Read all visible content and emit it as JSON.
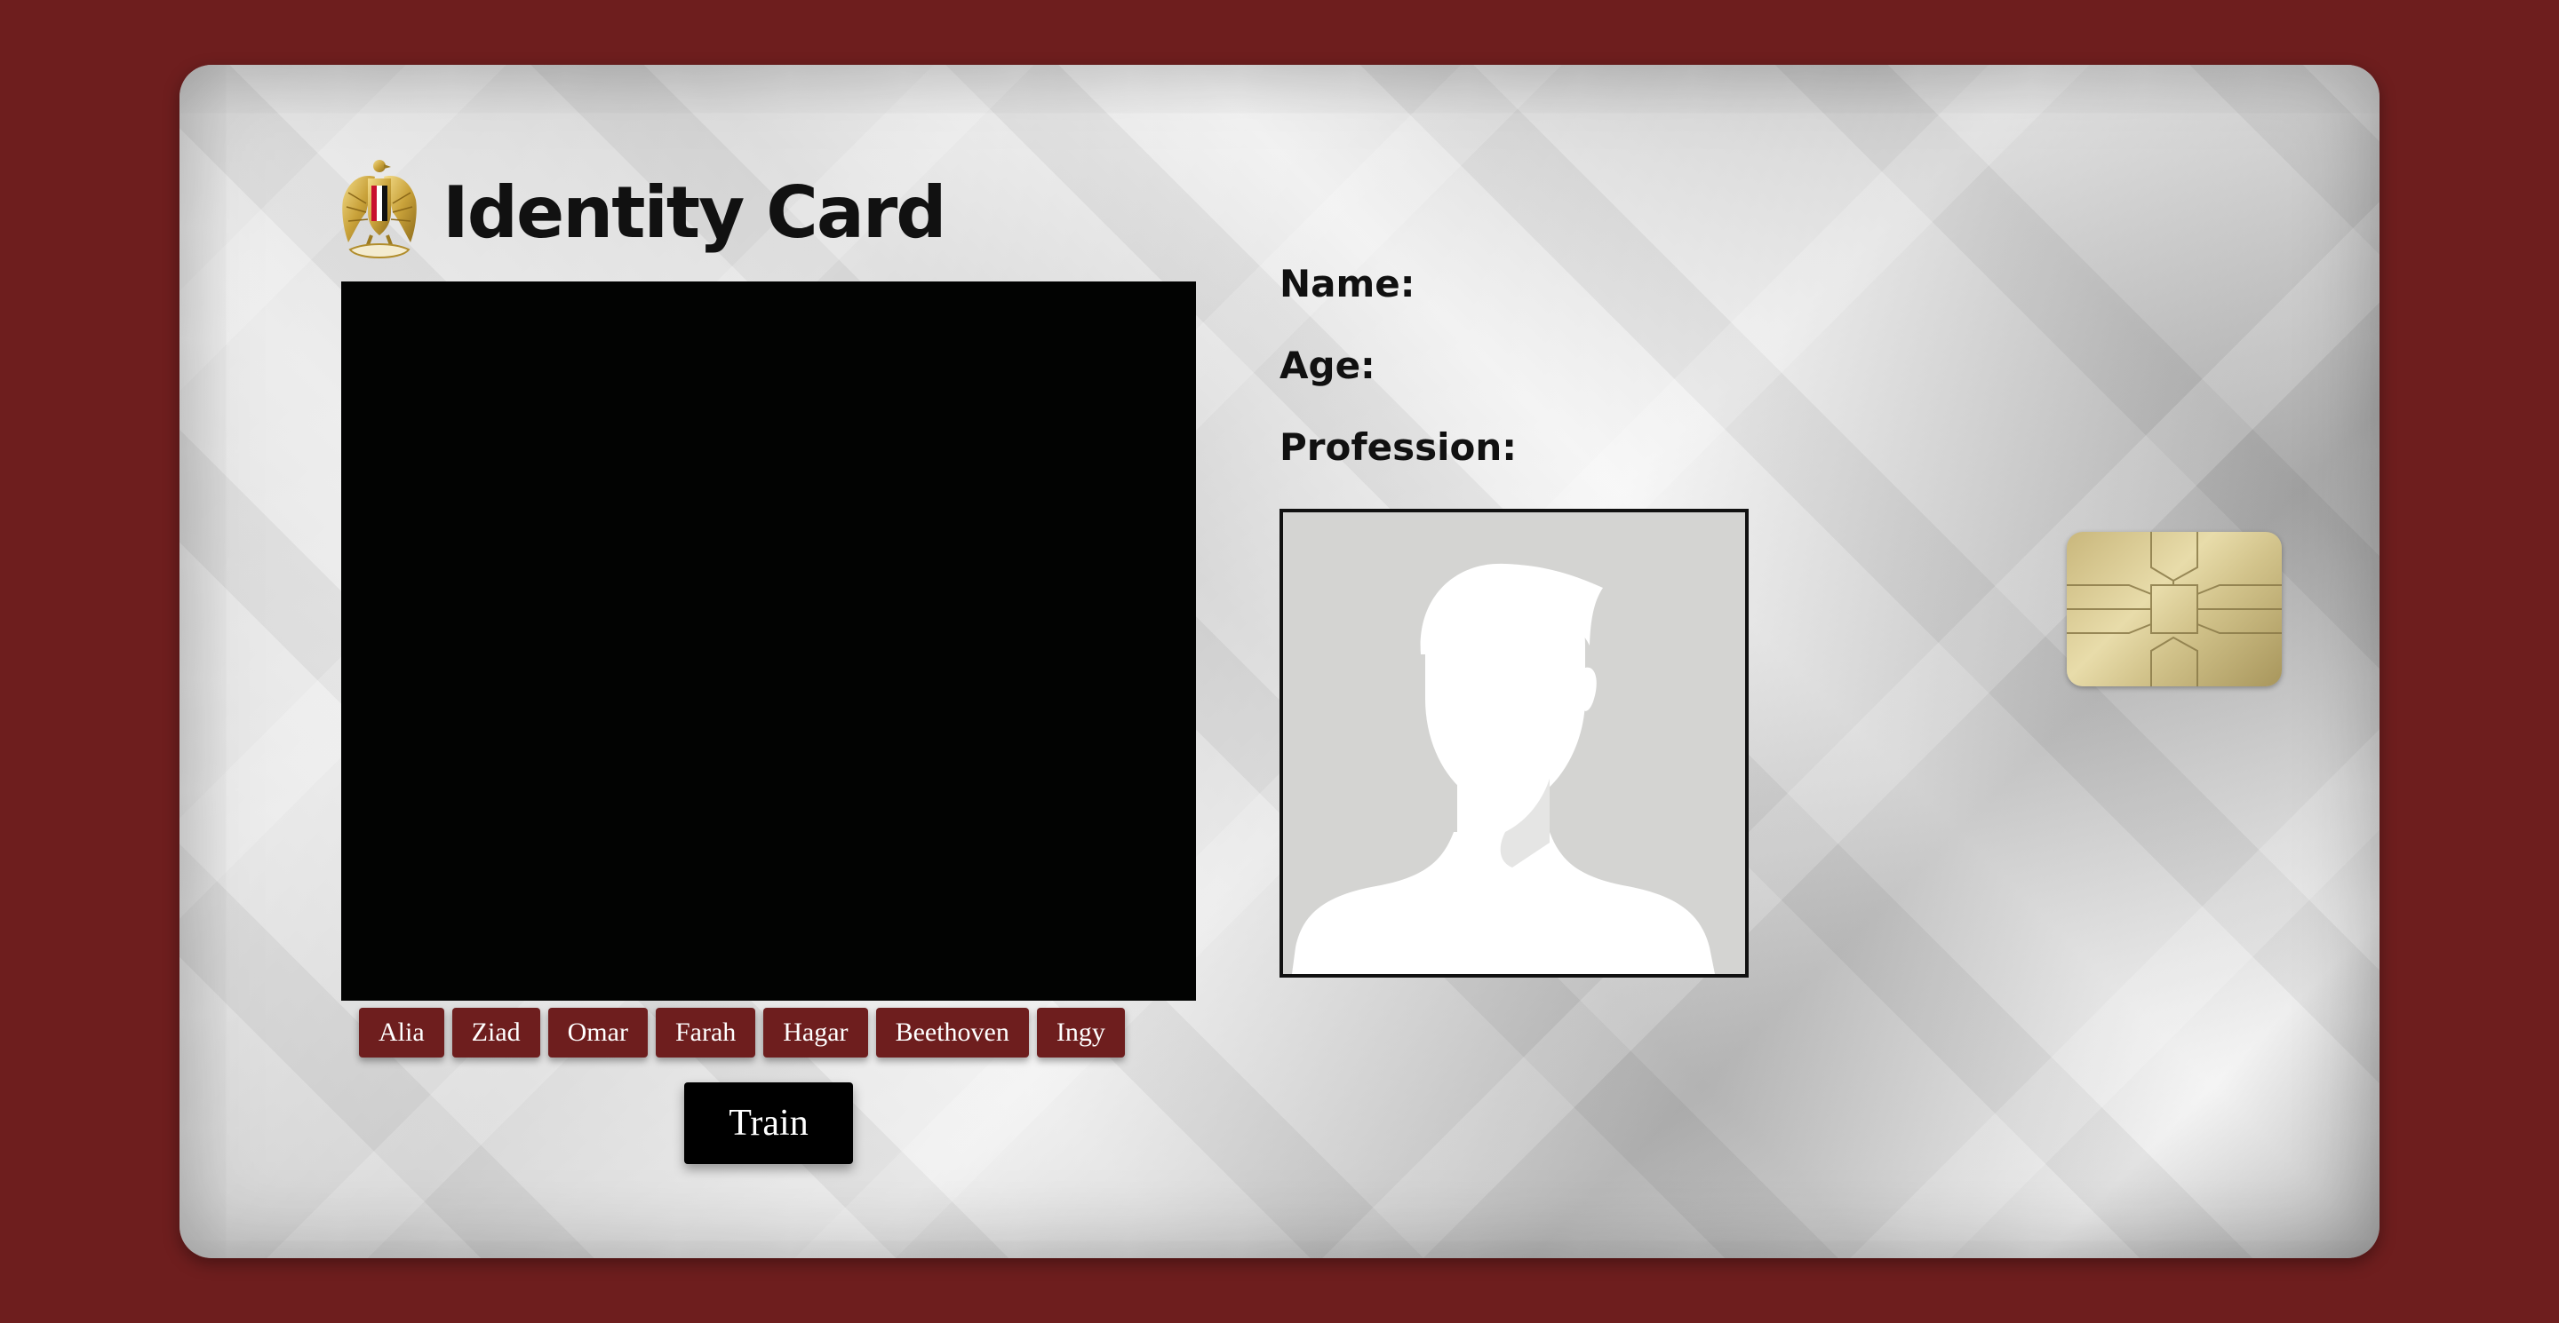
{
  "card": {
    "title": "Identity Card",
    "emblem_icon": "eagle-emblem-icon",
    "colors": {
      "background": "#6e1e1e",
      "button": "#6e1e1e",
      "train_button": "#000000",
      "video": "#020302"
    }
  },
  "fields": {
    "name_label": "Name:",
    "name_value": "",
    "age_label": "Age:",
    "age_value": "",
    "profession_label": "Profession:",
    "profession_value": ""
  },
  "photo": {
    "icon": "avatar-placeholder-icon"
  },
  "people": [
    {
      "label": "Alia"
    },
    {
      "label": "Ziad"
    },
    {
      "label": "Omar"
    },
    {
      "label": "Farah"
    },
    {
      "label": "Hagar"
    },
    {
      "label": "Beethoven"
    },
    {
      "label": "Ingy"
    }
  ],
  "train": {
    "label": "Train"
  },
  "chip": {
    "icon": "smart-chip-icon"
  }
}
